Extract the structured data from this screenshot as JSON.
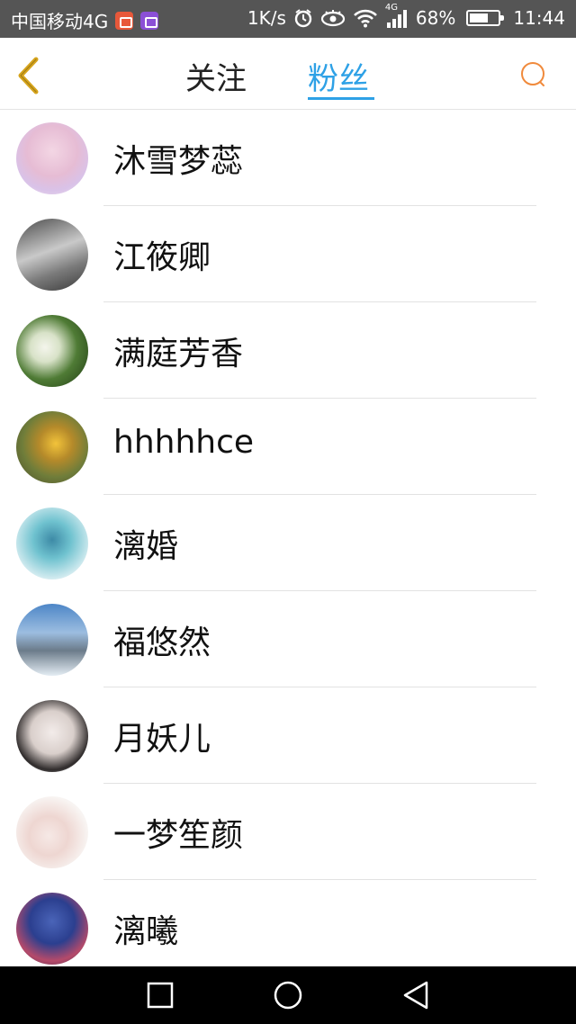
{
  "status_bar": {
    "carrier": "中国移动4G",
    "net_speed": "1K/s",
    "network_type": "4G",
    "battery_percent": "68%",
    "battery_level": 0.68,
    "time": "11:44"
  },
  "header": {
    "tabs": [
      {
        "label": "关注",
        "active": false
      },
      {
        "label": "粉丝",
        "active": true
      }
    ],
    "accent_color": "#2ea1e6",
    "back_icon": "chevron-left-icon",
    "search_icon": "search-icon"
  },
  "fans": [
    {
      "name": "沐雪梦蕊"
    },
    {
      "name": "江筱卿"
    },
    {
      "name": "满庭芳香"
    },
    {
      "name": "hhhhhce"
    },
    {
      "name": "漓婚"
    },
    {
      "name": "福悠然"
    },
    {
      "name": "月妖儿"
    },
    {
      "name": "一梦笙颜"
    },
    {
      "name": "漓曦"
    }
  ],
  "nav_bar": {
    "buttons": [
      "recent-apps-icon",
      "home-icon",
      "back-icon"
    ]
  }
}
